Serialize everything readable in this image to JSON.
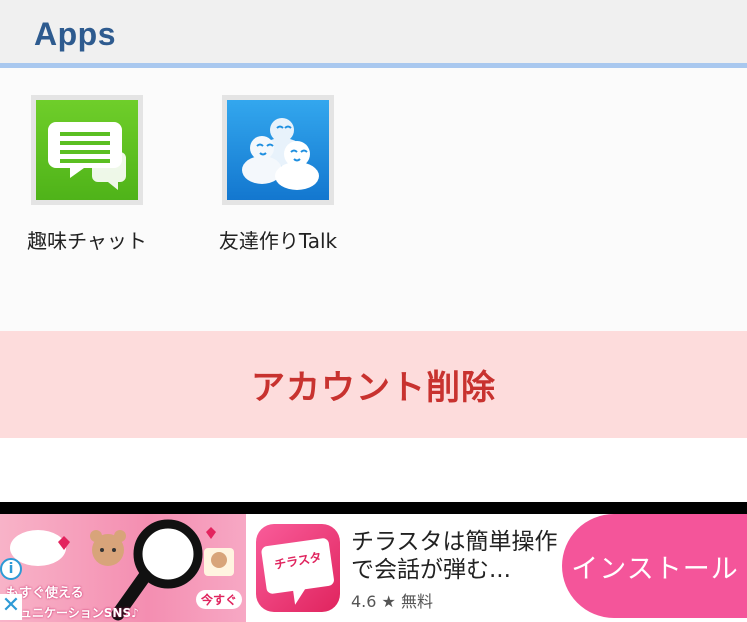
{
  "header": {
    "title": "Apps"
  },
  "apps": [
    {
      "label": "趣味チャット",
      "icon": "chat-bubbles-icon",
      "color": "#5bbf22"
    },
    {
      "label": "友達作りTalk",
      "icon": "friends-group-icon",
      "color": "#1f8fe0"
    }
  ],
  "account": {
    "delete_label": "アカウント削除"
  },
  "ad": {
    "banner_text_1": "もすぐ使える",
    "banner_text_2": "ミュニケーションSNS♪",
    "banner_text_3": "今すぐ",
    "info_glyph": "i",
    "close_glyph": "✕",
    "app_title": "チラスタは簡単操作で会話が弾む...",
    "rating": "4.6",
    "star": "★",
    "price": "無料",
    "install_label": "インストール",
    "app_icon_text": "チラスタ",
    "accent": "#f4559a"
  }
}
